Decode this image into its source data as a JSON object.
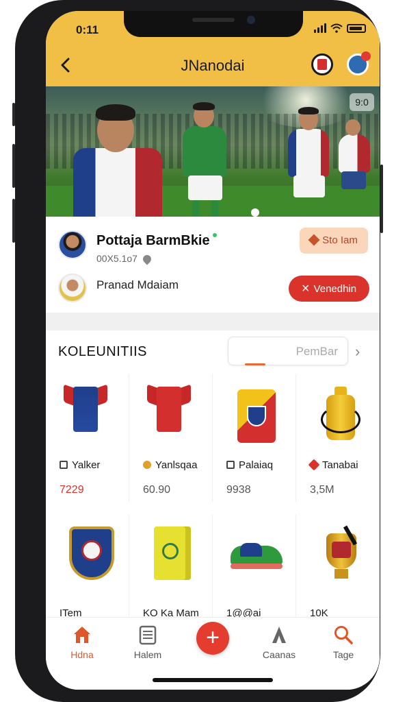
{
  "status_bar": {
    "time": "0:11"
  },
  "header": {
    "title": "JNanodai"
  },
  "banner": {
    "badge": "9:0"
  },
  "profile": {
    "name": "Pottaja BarmBkie",
    "meta": "00X5.1o7",
    "follow_label": "Sto Iam",
    "secondary_name": "Pranad Mdaiam",
    "message_label": "Venedhin",
    "message_icon": "×"
  },
  "section": {
    "title": "KOLEUNITIIS",
    "search_placeholder": "PemBar",
    "arrow": "›"
  },
  "products": [
    {
      "label": "Yalker",
      "price": "7229",
      "price_red": true,
      "icon": "tag-icon"
    },
    {
      "label": "Yanlsqaa",
      "price": "60.90",
      "price_red": false,
      "icon": "flame-icon"
    },
    {
      "label": "Palaiaq",
      "price": "9938",
      "price_red": false,
      "icon": "tag-icon"
    },
    {
      "label": "Tanabai",
      "price": "3,5M",
      "price_red": false,
      "icon": "maple-icon"
    },
    {
      "label": "ITem",
      "price": "",
      "price_red": false,
      "icon": ""
    },
    {
      "label": "KO Ka Mam",
      "price": "",
      "price_red": false,
      "icon": ""
    },
    {
      "label": "1@@ai",
      "price": "",
      "price_red": false,
      "icon": ""
    },
    {
      "label": "10K",
      "price": "",
      "price_red": false,
      "icon": ""
    }
  ],
  "nav": {
    "items": [
      {
        "label": "Hdna",
        "icon": "home-icon"
      },
      {
        "label": "Halem",
        "icon": "list-icon"
      },
      {
        "label": "+",
        "icon": "plus-icon"
      },
      {
        "label": "Caanas",
        "icon": "person-icon"
      },
      {
        "label": "Tage",
        "icon": "search-icon"
      }
    ]
  },
  "colors": {
    "header_yellow": "#f2bf46",
    "accent_red": "#d9332c",
    "nav_active": "#e0562b"
  }
}
